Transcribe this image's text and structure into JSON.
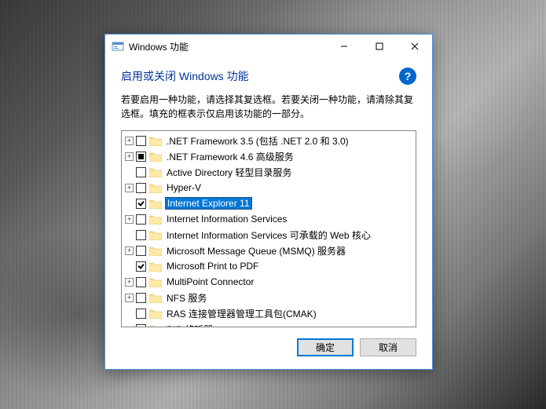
{
  "window": {
    "title": "Windows 功能"
  },
  "heading": "启用或关闭 Windows 功能",
  "description": "若要启用一种功能，请选择其复选框。若要关闭一种功能，请清除其复选框。填充的框表示仅启用该功能的一部分。",
  "features": [
    {
      "label": ".NET Framework 3.5 (包括 .NET 2.0 和 3.0)",
      "expandable": true,
      "check": "empty",
      "selected": false
    },
    {
      "label": ".NET Framework 4.6 高级服务",
      "expandable": true,
      "check": "filled",
      "selected": false
    },
    {
      "label": "Active Directory 轻型目录服务",
      "expandable": false,
      "check": "empty",
      "selected": false
    },
    {
      "label": "Hyper-V",
      "expandable": true,
      "check": "empty",
      "selected": false
    },
    {
      "label": "Internet Explorer 11",
      "expandable": false,
      "check": "checked",
      "selected": true
    },
    {
      "label": "Internet Information Services",
      "expandable": true,
      "check": "empty",
      "selected": false
    },
    {
      "label": "Internet Information Services 可承载的 Web 核心",
      "expandable": false,
      "check": "empty",
      "selected": false
    },
    {
      "label": "Microsoft Message Queue (MSMQ) 服务器",
      "expandable": true,
      "check": "empty",
      "selected": false
    },
    {
      "label": "Microsoft Print to PDF",
      "expandable": false,
      "check": "checked",
      "selected": false
    },
    {
      "label": "MultiPoint Connector",
      "expandable": true,
      "check": "empty",
      "selected": false
    },
    {
      "label": "NFS 服务",
      "expandable": true,
      "check": "empty",
      "selected": false
    },
    {
      "label": "RAS 连接管理器管理工具包(CMAK)",
      "expandable": false,
      "check": "empty",
      "selected": false
    },
    {
      "label": "RIP 侦听器",
      "expandable": false,
      "check": "empty",
      "selected": false
    }
  ],
  "buttons": {
    "ok": "确定",
    "cancel": "取消"
  }
}
